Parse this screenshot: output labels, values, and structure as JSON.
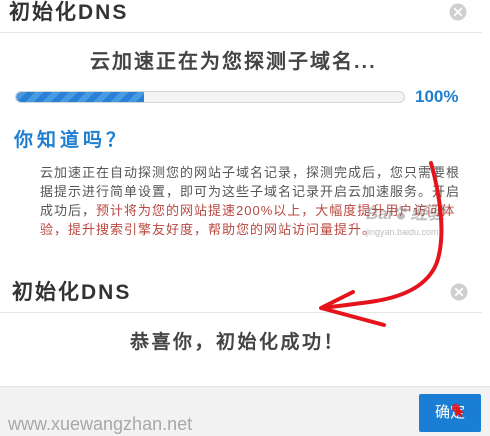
{
  "colors": {
    "accent_blue": "#1f7fd0",
    "button_blue": "#1a7fd4",
    "highlight_red": "#b9473f",
    "annotation_red": "#e5141c",
    "close_grey": "#cfcfcf"
  },
  "dialog1": {
    "title": "初始化DNS",
    "close_icon": "close-icon",
    "status_text": "云加速正在为您探测子域名...",
    "progress": {
      "fill_fraction": 0.33,
      "label": "100%"
    },
    "tip": {
      "heading": "你知道吗？",
      "text_normal": "云加速正在自动探测您的网站子域名记录，探测完成后，您只需要根据提示进行简单设置，即可为这些子域名记录开启云加速服务。开启成功后，",
      "text_highlight": "预计将为您的网站提速200%以上，大幅度提升用户访问体验，提升搜索引擎友好度，帮助您的网站访问量提升。"
    }
  },
  "watermark": {
    "brand_prefix": "Bai",
    "icon": "paw-icon",
    "brand_suffix": "经验",
    "site": "jingyan.baidu.com"
  },
  "annotation": {
    "icon": "hand-drawn-arrow-icon"
  },
  "dialog2": {
    "title": "初始化DNS",
    "close_icon": "close-icon",
    "success_text": "恭喜你，初始化成功！",
    "footer_site": "www.xuewangzhan.net",
    "confirm_label": "确定",
    "cursor_icon": "cursor-marker-icon"
  }
}
